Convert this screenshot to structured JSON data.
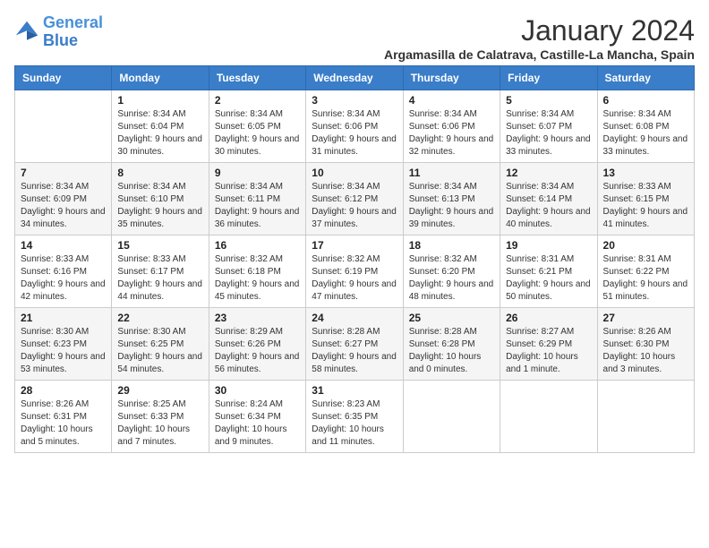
{
  "logo": {
    "line1": "General",
    "line2": "Blue"
  },
  "title": "January 2024",
  "location": "Argamasilla de Calatrava, Castille-La Mancha, Spain",
  "days_of_week": [
    "Sunday",
    "Monday",
    "Tuesday",
    "Wednesday",
    "Thursday",
    "Friday",
    "Saturday"
  ],
  "weeks": [
    [
      {
        "day": "",
        "sunrise": "",
        "sunset": "",
        "daylight": ""
      },
      {
        "day": "1",
        "sunrise": "Sunrise: 8:34 AM",
        "sunset": "Sunset: 6:04 PM",
        "daylight": "Daylight: 9 hours and 30 minutes."
      },
      {
        "day": "2",
        "sunrise": "Sunrise: 8:34 AM",
        "sunset": "Sunset: 6:05 PM",
        "daylight": "Daylight: 9 hours and 30 minutes."
      },
      {
        "day": "3",
        "sunrise": "Sunrise: 8:34 AM",
        "sunset": "Sunset: 6:06 PM",
        "daylight": "Daylight: 9 hours and 31 minutes."
      },
      {
        "day": "4",
        "sunrise": "Sunrise: 8:34 AM",
        "sunset": "Sunset: 6:06 PM",
        "daylight": "Daylight: 9 hours and 32 minutes."
      },
      {
        "day": "5",
        "sunrise": "Sunrise: 8:34 AM",
        "sunset": "Sunset: 6:07 PM",
        "daylight": "Daylight: 9 hours and 33 minutes."
      },
      {
        "day": "6",
        "sunrise": "Sunrise: 8:34 AM",
        "sunset": "Sunset: 6:08 PM",
        "daylight": "Daylight: 9 hours and 33 minutes."
      }
    ],
    [
      {
        "day": "7",
        "sunrise": "Sunrise: 8:34 AM",
        "sunset": "Sunset: 6:09 PM",
        "daylight": "Daylight: 9 hours and 34 minutes."
      },
      {
        "day": "8",
        "sunrise": "Sunrise: 8:34 AM",
        "sunset": "Sunset: 6:10 PM",
        "daylight": "Daylight: 9 hours and 35 minutes."
      },
      {
        "day": "9",
        "sunrise": "Sunrise: 8:34 AM",
        "sunset": "Sunset: 6:11 PM",
        "daylight": "Daylight: 9 hours and 36 minutes."
      },
      {
        "day": "10",
        "sunrise": "Sunrise: 8:34 AM",
        "sunset": "Sunset: 6:12 PM",
        "daylight": "Daylight: 9 hours and 37 minutes."
      },
      {
        "day": "11",
        "sunrise": "Sunrise: 8:34 AM",
        "sunset": "Sunset: 6:13 PM",
        "daylight": "Daylight: 9 hours and 39 minutes."
      },
      {
        "day": "12",
        "sunrise": "Sunrise: 8:34 AM",
        "sunset": "Sunset: 6:14 PM",
        "daylight": "Daylight: 9 hours and 40 minutes."
      },
      {
        "day": "13",
        "sunrise": "Sunrise: 8:33 AM",
        "sunset": "Sunset: 6:15 PM",
        "daylight": "Daylight: 9 hours and 41 minutes."
      }
    ],
    [
      {
        "day": "14",
        "sunrise": "Sunrise: 8:33 AM",
        "sunset": "Sunset: 6:16 PM",
        "daylight": "Daylight: 9 hours and 42 minutes."
      },
      {
        "day": "15",
        "sunrise": "Sunrise: 8:33 AM",
        "sunset": "Sunset: 6:17 PM",
        "daylight": "Daylight: 9 hours and 44 minutes."
      },
      {
        "day": "16",
        "sunrise": "Sunrise: 8:32 AM",
        "sunset": "Sunset: 6:18 PM",
        "daylight": "Daylight: 9 hours and 45 minutes."
      },
      {
        "day": "17",
        "sunrise": "Sunrise: 8:32 AM",
        "sunset": "Sunset: 6:19 PM",
        "daylight": "Daylight: 9 hours and 47 minutes."
      },
      {
        "day": "18",
        "sunrise": "Sunrise: 8:32 AM",
        "sunset": "Sunset: 6:20 PM",
        "daylight": "Daylight: 9 hours and 48 minutes."
      },
      {
        "day": "19",
        "sunrise": "Sunrise: 8:31 AM",
        "sunset": "Sunset: 6:21 PM",
        "daylight": "Daylight: 9 hours and 50 minutes."
      },
      {
        "day": "20",
        "sunrise": "Sunrise: 8:31 AM",
        "sunset": "Sunset: 6:22 PM",
        "daylight": "Daylight: 9 hours and 51 minutes."
      }
    ],
    [
      {
        "day": "21",
        "sunrise": "Sunrise: 8:30 AM",
        "sunset": "Sunset: 6:23 PM",
        "daylight": "Daylight: 9 hours and 53 minutes."
      },
      {
        "day": "22",
        "sunrise": "Sunrise: 8:30 AM",
        "sunset": "Sunset: 6:25 PM",
        "daylight": "Daylight: 9 hours and 54 minutes."
      },
      {
        "day": "23",
        "sunrise": "Sunrise: 8:29 AM",
        "sunset": "Sunset: 6:26 PM",
        "daylight": "Daylight: 9 hours and 56 minutes."
      },
      {
        "day": "24",
        "sunrise": "Sunrise: 8:28 AM",
        "sunset": "Sunset: 6:27 PM",
        "daylight": "Daylight: 9 hours and 58 minutes."
      },
      {
        "day": "25",
        "sunrise": "Sunrise: 8:28 AM",
        "sunset": "Sunset: 6:28 PM",
        "daylight": "Daylight: 10 hours and 0 minutes."
      },
      {
        "day": "26",
        "sunrise": "Sunrise: 8:27 AM",
        "sunset": "Sunset: 6:29 PM",
        "daylight": "Daylight: 10 hours and 1 minute."
      },
      {
        "day": "27",
        "sunrise": "Sunrise: 8:26 AM",
        "sunset": "Sunset: 6:30 PM",
        "daylight": "Daylight: 10 hours and 3 minutes."
      }
    ],
    [
      {
        "day": "28",
        "sunrise": "Sunrise: 8:26 AM",
        "sunset": "Sunset: 6:31 PM",
        "daylight": "Daylight: 10 hours and 5 minutes."
      },
      {
        "day": "29",
        "sunrise": "Sunrise: 8:25 AM",
        "sunset": "Sunset: 6:33 PM",
        "daylight": "Daylight: 10 hours and 7 minutes."
      },
      {
        "day": "30",
        "sunrise": "Sunrise: 8:24 AM",
        "sunset": "Sunset: 6:34 PM",
        "daylight": "Daylight: 10 hours and 9 minutes."
      },
      {
        "day": "31",
        "sunrise": "Sunrise: 8:23 AM",
        "sunset": "Sunset: 6:35 PM",
        "daylight": "Daylight: 10 hours and 11 minutes."
      },
      {
        "day": "",
        "sunrise": "",
        "sunset": "",
        "daylight": ""
      },
      {
        "day": "",
        "sunrise": "",
        "sunset": "",
        "daylight": ""
      },
      {
        "day": "",
        "sunrise": "",
        "sunset": "",
        "daylight": ""
      }
    ]
  ]
}
